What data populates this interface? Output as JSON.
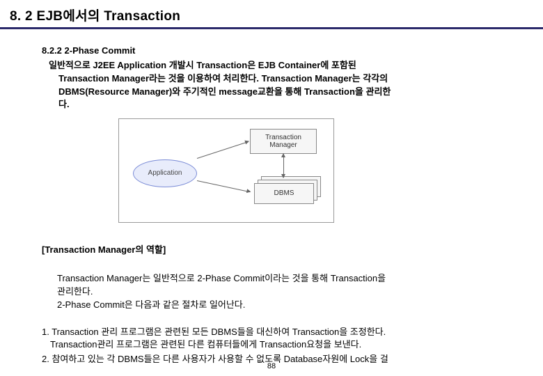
{
  "header": {
    "title": "8. 2 EJB에서의 Transaction"
  },
  "section": {
    "sub_heading": "8.2.2 2-Phase Commit",
    "para1_line1": "일반적으로 J2EE Application 개발시 Transaction은 EJB Container에 포함된",
    "para1_line2": "Transaction Manager라는 것을 이용하여 처리한다. Transaction Manager는 각각의",
    "para1_line3": "DBMS(Resource Manager)와 주기적인 message교환을 통해 Transaction을 관리한",
    "para1_line4": "다."
  },
  "diagram": {
    "application_label": "Application",
    "tm_label": "Transaction\nManager",
    "dbms_label": "DBMS"
  },
  "caption": "[Transaction Manager의 역할]",
  "para2_line1": "Transaction Manager는 일반적으로 2-Phase Commit이라는 것을 통해 Transaction을",
  "para2_line2": "관리한다.",
  "para2_line3": "2-Phase Commit은 다음과 같은 절차로 일어난다.",
  "list_item1_a": "1. Transaction 관리 프로그램은 관련된 모든 DBMS들을 대신하여 Transaction을 조정한다.",
  "list_item1_b": "Transaction관리 프로그램은 관련된 다른 컴퓨터들에게 Transaction요청을 보낸다.",
  "cutoff_line": "2. 참여하고 있는 각 DBMS들은 다른 사용자가 사용할 수 없도록 Database자원에 Lock을 걸",
  "page_number": "88"
}
